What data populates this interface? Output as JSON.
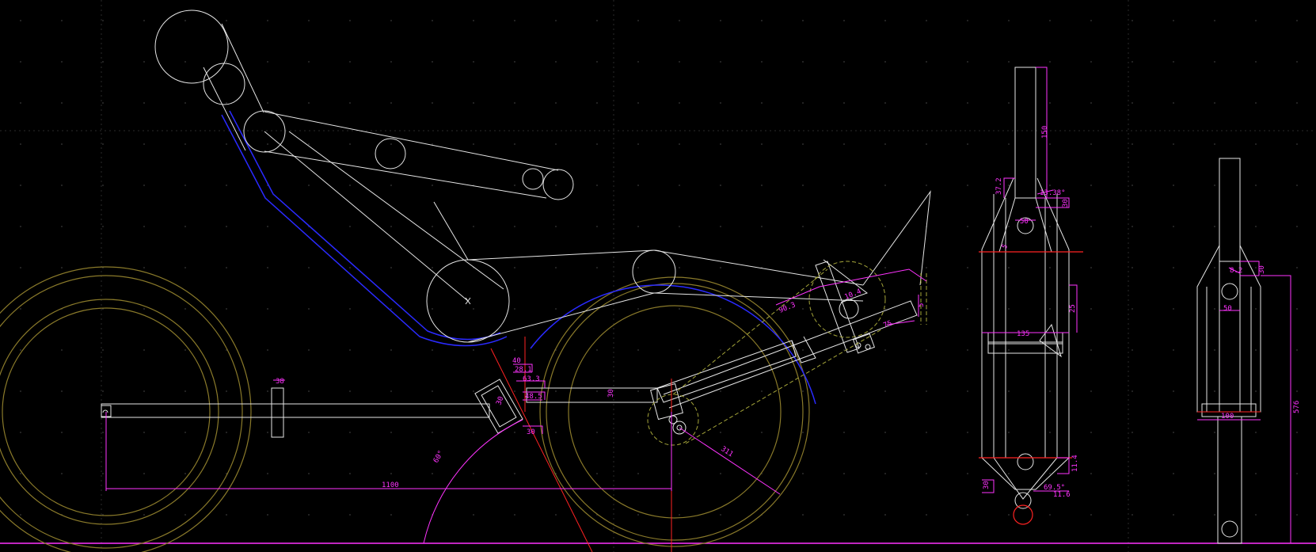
{
  "colors": {
    "background": "#000000",
    "frame_lines": "#e6e6e6",
    "dimensions": "#ff33ff",
    "seat_outline": "#2a2aff",
    "wheels": "#8a7a2a",
    "hidden_lines": "#a6a63a",
    "construction": "#ff2222",
    "grid_dots": "#3a3a3a"
  },
  "dimensions": {
    "wheelbase": "1100",
    "boom_height": "38",
    "bb_a": "40",
    "bb_b": "28.1",
    "bb_c": "63.3",
    "bb_d": "48.5",
    "bb_e": "30",
    "bb_f": "30",
    "chainstay_tube": "30",
    "head_angle": "60°",
    "rear_radius": "311",
    "tail_a": "90.3",
    "tail_b": "10.4",
    "tail_c": "75",
    "tail_d": "5"
  },
  "rear_view_dims": {
    "upper_tube": "150",
    "tube_height": "37.2",
    "angle": "13.38°",
    "stem": "30",
    "small_a": "50",
    "small_b": "5",
    "center_width": "135",
    "side_height": "25",
    "lower_a": "30",
    "lower_b": "11.4",
    "lower_c": "11.6",
    "lower_angle": "69.5°"
  },
  "side_view_dims": {
    "top_a": "30",
    "top_b": "8.2",
    "mid_width": "50",
    "bottom_width": "100",
    "total_height": "576"
  }
}
